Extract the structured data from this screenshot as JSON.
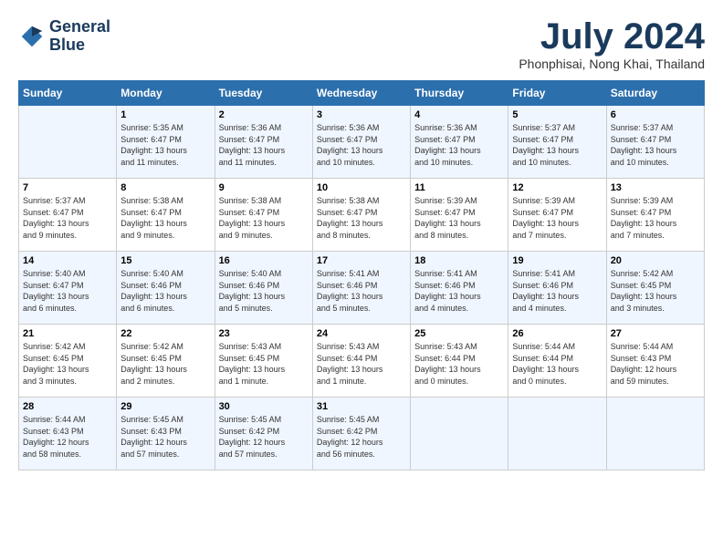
{
  "header": {
    "logo_line1": "General",
    "logo_line2": "Blue",
    "month_title": "July 2024",
    "location": "Phonphisai, Nong Khai, Thailand"
  },
  "days_of_week": [
    "Sunday",
    "Monday",
    "Tuesday",
    "Wednesday",
    "Thursday",
    "Friday",
    "Saturday"
  ],
  "weeks": [
    [
      {
        "day": "",
        "info": ""
      },
      {
        "day": "1",
        "info": "Sunrise: 5:35 AM\nSunset: 6:47 PM\nDaylight: 13 hours\nand 11 minutes."
      },
      {
        "day": "2",
        "info": "Sunrise: 5:36 AM\nSunset: 6:47 PM\nDaylight: 13 hours\nand 11 minutes."
      },
      {
        "day": "3",
        "info": "Sunrise: 5:36 AM\nSunset: 6:47 PM\nDaylight: 13 hours\nand 10 minutes."
      },
      {
        "day": "4",
        "info": "Sunrise: 5:36 AM\nSunset: 6:47 PM\nDaylight: 13 hours\nand 10 minutes."
      },
      {
        "day": "5",
        "info": "Sunrise: 5:37 AM\nSunset: 6:47 PM\nDaylight: 13 hours\nand 10 minutes."
      },
      {
        "day": "6",
        "info": "Sunrise: 5:37 AM\nSunset: 6:47 PM\nDaylight: 13 hours\nand 10 minutes."
      }
    ],
    [
      {
        "day": "7",
        "info": "Sunrise: 5:37 AM\nSunset: 6:47 PM\nDaylight: 13 hours\nand 9 minutes."
      },
      {
        "day": "8",
        "info": "Sunrise: 5:38 AM\nSunset: 6:47 PM\nDaylight: 13 hours\nand 9 minutes."
      },
      {
        "day": "9",
        "info": "Sunrise: 5:38 AM\nSunset: 6:47 PM\nDaylight: 13 hours\nand 9 minutes."
      },
      {
        "day": "10",
        "info": "Sunrise: 5:38 AM\nSunset: 6:47 PM\nDaylight: 13 hours\nand 8 minutes."
      },
      {
        "day": "11",
        "info": "Sunrise: 5:39 AM\nSunset: 6:47 PM\nDaylight: 13 hours\nand 8 minutes."
      },
      {
        "day": "12",
        "info": "Sunrise: 5:39 AM\nSunset: 6:47 PM\nDaylight: 13 hours\nand 7 minutes."
      },
      {
        "day": "13",
        "info": "Sunrise: 5:39 AM\nSunset: 6:47 PM\nDaylight: 13 hours\nand 7 minutes."
      }
    ],
    [
      {
        "day": "14",
        "info": "Sunrise: 5:40 AM\nSunset: 6:47 PM\nDaylight: 13 hours\nand 6 minutes."
      },
      {
        "day": "15",
        "info": "Sunrise: 5:40 AM\nSunset: 6:46 PM\nDaylight: 13 hours\nand 6 minutes."
      },
      {
        "day": "16",
        "info": "Sunrise: 5:40 AM\nSunset: 6:46 PM\nDaylight: 13 hours\nand 5 minutes."
      },
      {
        "day": "17",
        "info": "Sunrise: 5:41 AM\nSunset: 6:46 PM\nDaylight: 13 hours\nand 5 minutes."
      },
      {
        "day": "18",
        "info": "Sunrise: 5:41 AM\nSunset: 6:46 PM\nDaylight: 13 hours\nand 4 minutes."
      },
      {
        "day": "19",
        "info": "Sunrise: 5:41 AM\nSunset: 6:46 PM\nDaylight: 13 hours\nand 4 minutes."
      },
      {
        "day": "20",
        "info": "Sunrise: 5:42 AM\nSunset: 6:45 PM\nDaylight: 13 hours\nand 3 minutes."
      }
    ],
    [
      {
        "day": "21",
        "info": "Sunrise: 5:42 AM\nSunset: 6:45 PM\nDaylight: 13 hours\nand 3 minutes."
      },
      {
        "day": "22",
        "info": "Sunrise: 5:42 AM\nSunset: 6:45 PM\nDaylight: 13 hours\nand 2 minutes."
      },
      {
        "day": "23",
        "info": "Sunrise: 5:43 AM\nSunset: 6:45 PM\nDaylight: 13 hours\nand 1 minute."
      },
      {
        "day": "24",
        "info": "Sunrise: 5:43 AM\nSunset: 6:44 PM\nDaylight: 13 hours\nand 1 minute."
      },
      {
        "day": "25",
        "info": "Sunrise: 5:43 AM\nSunset: 6:44 PM\nDaylight: 13 hours\nand 0 minutes."
      },
      {
        "day": "26",
        "info": "Sunrise: 5:44 AM\nSunset: 6:44 PM\nDaylight: 13 hours\nand 0 minutes."
      },
      {
        "day": "27",
        "info": "Sunrise: 5:44 AM\nSunset: 6:43 PM\nDaylight: 12 hours\nand 59 minutes."
      }
    ],
    [
      {
        "day": "28",
        "info": "Sunrise: 5:44 AM\nSunset: 6:43 PM\nDaylight: 12 hours\nand 58 minutes."
      },
      {
        "day": "29",
        "info": "Sunrise: 5:45 AM\nSunset: 6:43 PM\nDaylight: 12 hours\nand 57 minutes."
      },
      {
        "day": "30",
        "info": "Sunrise: 5:45 AM\nSunset: 6:42 PM\nDaylight: 12 hours\nand 57 minutes."
      },
      {
        "day": "31",
        "info": "Sunrise: 5:45 AM\nSunset: 6:42 PM\nDaylight: 12 hours\nand 56 minutes."
      },
      {
        "day": "",
        "info": ""
      },
      {
        "day": "",
        "info": ""
      },
      {
        "day": "",
        "info": ""
      }
    ]
  ]
}
